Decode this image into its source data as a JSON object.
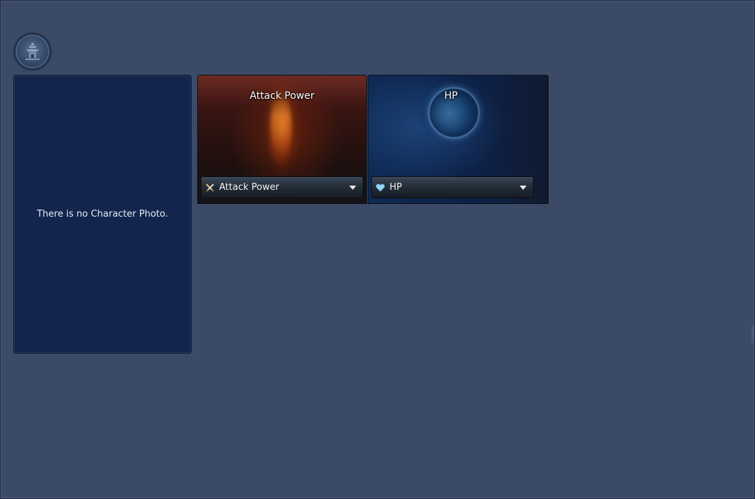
{
  "character": {
    "emblem_icon": "guild-emblem-icon",
    "photo_placeholder": "There is no Character Photo."
  },
  "stat_cards": [
    {
      "title": "Attack Power",
      "selected_stat": "Attack Power",
      "icon": "crossed-swords-icon",
      "theme_color": "#6d2a22"
    },
    {
      "title": "HP",
      "selected_stat": "HP",
      "icon": "heart-icon",
      "theme_color": "#0f2a55"
    }
  ],
  "colors": {
    "background": "#3b4a66",
    "photo_panel": "#13254d"
  }
}
